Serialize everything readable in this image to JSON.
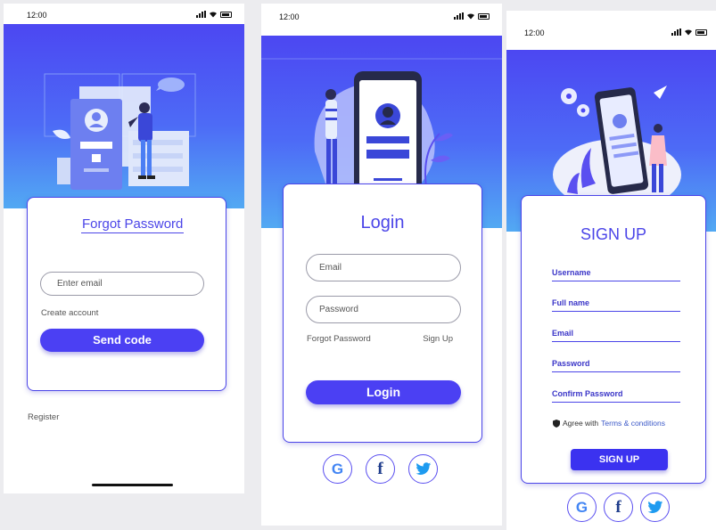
{
  "status_time": "12:00",
  "forgot_screen": {
    "title": "Forgot Password",
    "email_placeholder": "Enter email",
    "create_account": "Create account",
    "send_button": "Send code",
    "register_link": "Register"
  },
  "login_screen": {
    "title": "Login",
    "email_placeholder": "Email",
    "password_placeholder": "Password",
    "forgot_link": "Forgot Password",
    "signup_link": "Sign Up",
    "login_button": "Login"
  },
  "signup_screen": {
    "title": "SIGN UP",
    "fields": [
      "Username",
      "Full name",
      "Email",
      "Password",
      "Confirm Password"
    ],
    "agree_text": "Agree with",
    "terms_link": "Terms & conditions",
    "signup_button": "SIGN UP"
  },
  "colors": {
    "primary": "#4b40f3",
    "hero_top": "#4c47f2",
    "hero_bottom": "#52a9f3"
  },
  "social_icons": [
    "google-icon",
    "facebook-icon",
    "twitter-icon"
  ]
}
